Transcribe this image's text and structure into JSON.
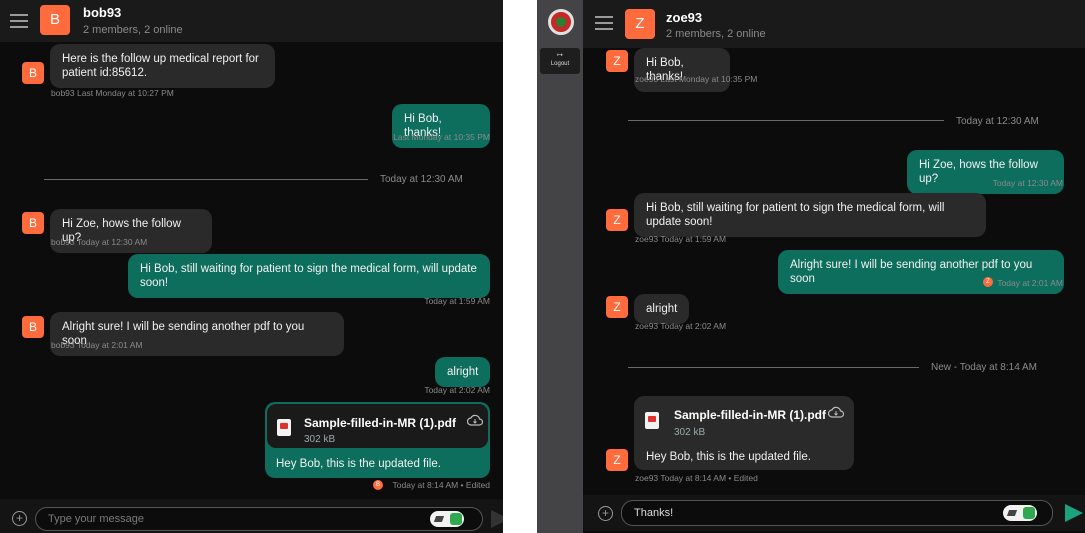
{
  "left": {
    "header": {
      "avatar": "B",
      "title": "bob93",
      "subtitle": "2 members, 2 online"
    },
    "messages": [
      {
        "text": "Here is the follow up medical report for patient id:85612.",
        "meta": "bob93 Last Monday at 10:27 PM",
        "avatar": "B"
      },
      {
        "text": "Hi Bob, thanks!",
        "meta": "Last Monday at 10:35 PM"
      },
      {
        "text": "Hi Zoe, hows the follow up?",
        "meta": "bob93 Today at 12:30 AM",
        "avatar": "B"
      },
      {
        "text": "Hi Bob, still waiting for patient to sign the medical form, will update soon!",
        "meta": "Today at 1:59 AM"
      },
      {
        "text": "Alright sure! I will be sending another pdf to you soon",
        "meta": "bob93 Today at 2:01 AM",
        "avatar": "B"
      },
      {
        "text": "alright",
        "meta": "Today at 2:02 AM"
      }
    ],
    "divider": "Today at 12:30 AM",
    "file": {
      "name": "Sample-filled-in-MR (1).pdf",
      "size": "302 kB",
      "caption": "Hey Bob, this is the updated file.",
      "meta": "Today at 8:14 AM • Edited",
      "badge": "B"
    },
    "composer": {
      "placeholder": "Type your message",
      "value": ""
    }
  },
  "right": {
    "sidebar": {
      "logout": "Logout"
    },
    "header": {
      "avatar": "Z",
      "title": "zoe93",
      "subtitle": "2 members, 2 online"
    },
    "messages": [
      {
        "text": "Hi Bob, thanks!",
        "meta": "zoe93 Last Monday at 10:35 PM",
        "avatar": "Z"
      },
      {
        "text": "Hi Zoe, hows the follow up?",
        "meta": "Today at 12:30 AM"
      },
      {
        "text": "Hi Bob, still waiting for patient to sign the medical form, will update soon!",
        "meta": "zoe93 Today at 1:59 AM",
        "avatar": "Z"
      },
      {
        "text": "Alright sure! I will be sending another pdf to you soon",
        "meta": "Today at 2:01 AM",
        "badge": "Z"
      },
      {
        "text": "alright",
        "meta": "zoe93 Today at 2:02 AM",
        "avatar": "Z"
      }
    ],
    "divider1": "Today at 12:30 AM",
    "divider2": "New - Today at 8:14 AM",
    "file": {
      "name": "Sample-filled-in-MR (1).pdf",
      "size": "302 kB",
      "caption": "Hey Bob, this is the updated file.",
      "meta": "zoe93 Today at 8:14 AM • Edited",
      "avatar": "Z"
    },
    "composer": {
      "placeholder": "Type your message",
      "value": "Thanks!"
    }
  },
  "colors": {
    "accent_avatar": "#ff6b3d",
    "outgoing_bubble": "#0e6e5e",
    "incoming_bubble": "#2a2a2b",
    "send": "#19a37f"
  }
}
